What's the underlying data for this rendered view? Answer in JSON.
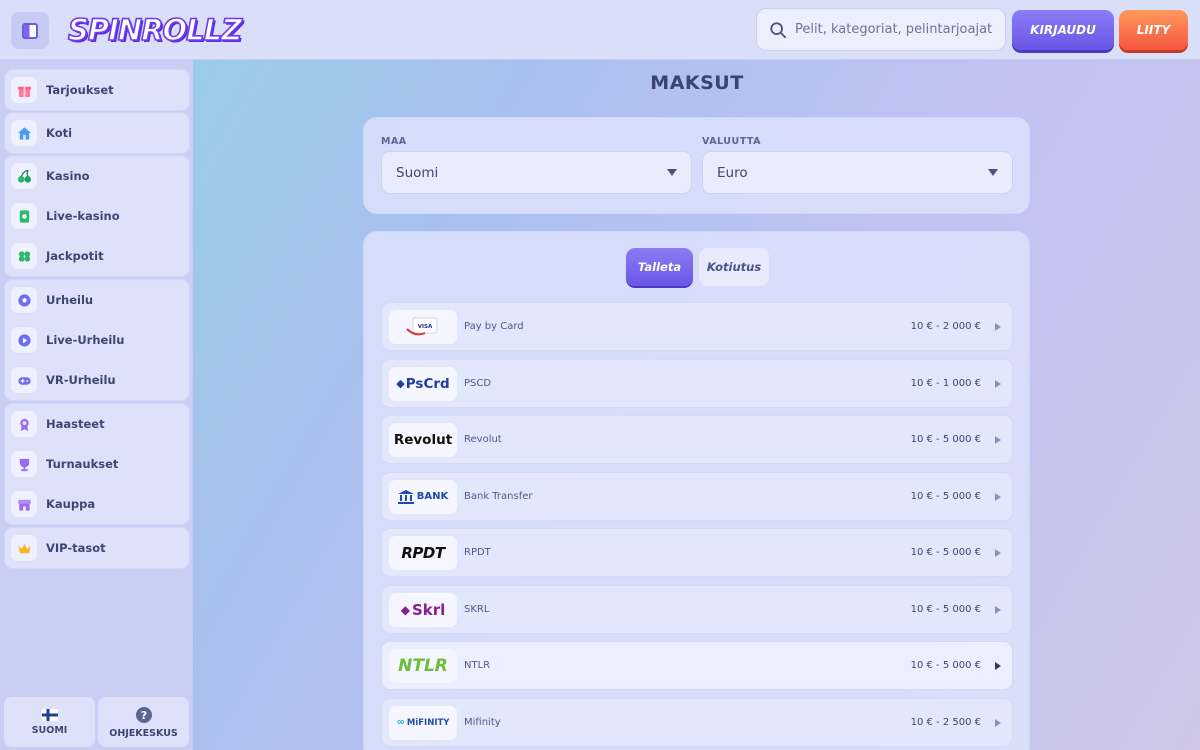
{
  "header": {
    "logo_text": "SPINROLLZ",
    "search_placeholder": "Pelit, kategoriat, pelintarjoajat",
    "login_label": "KIRJAUDU",
    "join_label": "LIITY"
  },
  "sidebar": {
    "groups": [
      [
        {
          "label": "Tarjoukset",
          "icon": "gift-icon"
        }
      ],
      [
        {
          "label": "Koti",
          "icon": "home-icon"
        }
      ],
      [
        {
          "label": "Kasino",
          "icon": "cherries-icon"
        },
        {
          "label": "Live-kasino",
          "icon": "cards-icon"
        },
        {
          "label": "Jackpotit",
          "icon": "clover-icon"
        }
      ],
      [
        {
          "label": "Urheilu",
          "icon": "soccer-ball-icon"
        },
        {
          "label": "Live-Urheilu",
          "icon": "play-icon"
        },
        {
          "label": "VR-Urheilu",
          "icon": "gamepad-icon"
        }
      ],
      [
        {
          "label": "Haasteet",
          "icon": "medal-icon"
        },
        {
          "label": "Turnaukset",
          "icon": "trophy-icon"
        },
        {
          "label": "Kauppa",
          "icon": "shop-icon"
        }
      ],
      [
        {
          "label": "VIP-tasot",
          "icon": "crown-icon"
        }
      ]
    ],
    "footer": {
      "language_label": "SUOMI",
      "help_label": "OHJEKESKUS"
    }
  },
  "main": {
    "title": "MAKSUT",
    "country": {
      "label": "MAA",
      "value": "Suomi"
    },
    "currency": {
      "label": "VALUUTTA",
      "value": "Euro"
    },
    "tabs": {
      "active": "Talleta",
      "inactive": "Kotiutus"
    },
    "methods": [
      {
        "logo": "VISA",
        "name": "Pay by Card",
        "range": "10 € - 2 000 €"
      },
      {
        "logo": "PsCrd",
        "name": "PSCD",
        "range": "10 € - 1 000 €"
      },
      {
        "logo": "Revolut",
        "name": "Revolut",
        "range": "10 € - 5 000 €"
      },
      {
        "logo": "BANK",
        "name": "Bank Transfer",
        "range": "10 € - 5 000 €"
      },
      {
        "logo": "RPDT",
        "name": "RPDT",
        "range": "10 € - 5 000 €"
      },
      {
        "logo": "Skrl",
        "name": "SKRL",
        "range": "10 € - 5 000 €"
      },
      {
        "logo": "NTLR",
        "name": "NTLR",
        "range": "10 € - 5 000 €"
      },
      {
        "logo": "MiFINITY",
        "name": "Mifinity",
        "range": "10 € - 2 500 €"
      }
    ]
  },
  "colors": {
    "accent": "#6a55e6",
    "join": "#f3553e"
  }
}
